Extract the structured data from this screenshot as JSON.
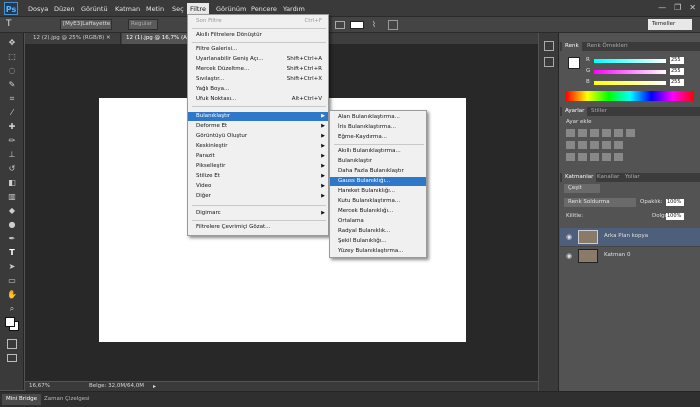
{
  "app": {
    "logo": "Ps"
  },
  "menubar": {
    "items": [
      "Dosya",
      "Düzen",
      "Görüntü",
      "Katman",
      "Metin",
      "Seç",
      "Filtre",
      "Görünüm",
      "Pencere",
      "Yardım"
    ]
  },
  "window_controls": {
    "minimize": "—",
    "restore": "❐",
    "close": "✕"
  },
  "options": {
    "tool_glyph": "T",
    "font_name": "[MyE3]Laffayette...",
    "font_style": "Regular",
    "workspace": "Temeller"
  },
  "tabs": [
    {
      "label": "12 (2).jpg @ 25% (RGB/8) ✕"
    },
    {
      "label": "12 (1).jpg @ 16,7% (Arka Plan kopya, RGB/8) ✕"
    }
  ],
  "status": {
    "zoom": "16,67%",
    "doc_size": "Belge: 32,0M/64,0M"
  },
  "bottom_tabs": [
    "Mini Bridge",
    "Zaman Çizelgesi"
  ],
  "filter_menu": {
    "items": [
      {
        "label": "Son Filtre",
        "shortcut": "Ctrl+F",
        "disabled": true
      },
      {
        "label": "Akıllı Filtrelere Dönüştür"
      },
      {
        "label": "Filtre Galerisi..."
      },
      {
        "label": "Uyarlanabilir Geniş Açı...",
        "shortcut": "Shift+Ctrl+A"
      },
      {
        "label": "Mercek Düzeltme...",
        "shortcut": "Shift+Ctrl+R"
      },
      {
        "label": "Sıvılaştır...",
        "shortcut": "Shift+Ctrl+X"
      },
      {
        "label": "Yağlı Boya..."
      },
      {
        "label": "Ufuk Noktası...",
        "shortcut": "Alt+Ctrl+V"
      },
      {
        "label": "Bulanıklaştır",
        "highlighted": true
      },
      {
        "label": "Deforme Et"
      },
      {
        "label": "Görüntüyü Oluştur"
      },
      {
        "label": "Keskinleştir"
      },
      {
        "label": "Parazit"
      },
      {
        "label": "Pikselleştir"
      },
      {
        "label": "Stilize Et"
      },
      {
        "label": "Video"
      },
      {
        "label": "Diğer"
      },
      {
        "label": "Digimarc"
      },
      {
        "label": "Filtrelere Çevrimiçi Gözat..."
      }
    ]
  },
  "blur_submenu": {
    "items": [
      {
        "label": "Alan Bulanıklaştırma..."
      },
      {
        "label": "İris Bulanıklaştırma..."
      },
      {
        "label": "Eğme-Kaydırma..."
      },
      {
        "label": "Akıllı Bulanıklaştırma..."
      },
      {
        "label": "Bulanıklaştır"
      },
      {
        "label": "Daha Fazla Bulanıklaştır"
      },
      {
        "label": "Gauss Bulanıklığı...",
        "highlighted": true
      },
      {
        "label": "Hareket Bulanıklığı..."
      },
      {
        "label": "Kutu Bulanıklaştırma..."
      },
      {
        "label": "Mercek Bulanıklığı..."
      },
      {
        "label": "Ortalama"
      },
      {
        "label": "Radyal Bulanıklık..."
      },
      {
        "label": "Şekil Bulanıklığı..."
      },
      {
        "label": "Yüzey Bulanıklaştırma..."
      }
    ]
  },
  "color_panel": {
    "tabs": [
      "Renk",
      "Renk Örnekleri"
    ],
    "channels": [
      {
        "label": "R",
        "value": "255"
      },
      {
        "label": "G",
        "value": "255"
      },
      {
        "label": "B",
        "value": "255"
      }
    ]
  },
  "adjustments_panel": {
    "tabs": [
      "Ayarlar",
      "Stiller"
    ],
    "title": "Ayar ekle"
  },
  "layers_panel": {
    "tabs": [
      "Katmanlar",
      "Kanallar",
      "Yollar"
    ],
    "kind_filter": "Çeşit",
    "blend_mode": "Renk Soldurma",
    "opacity_label": "Opaklık:",
    "opacity_value": "100%",
    "lock_label": "Kilitle:",
    "fill_label": "Dolgu:",
    "fill_value": "100%",
    "layers": [
      {
        "name": "Arka Plan kopya",
        "selected": true
      },
      {
        "name": "Katman 0",
        "selected": false
      }
    ]
  }
}
